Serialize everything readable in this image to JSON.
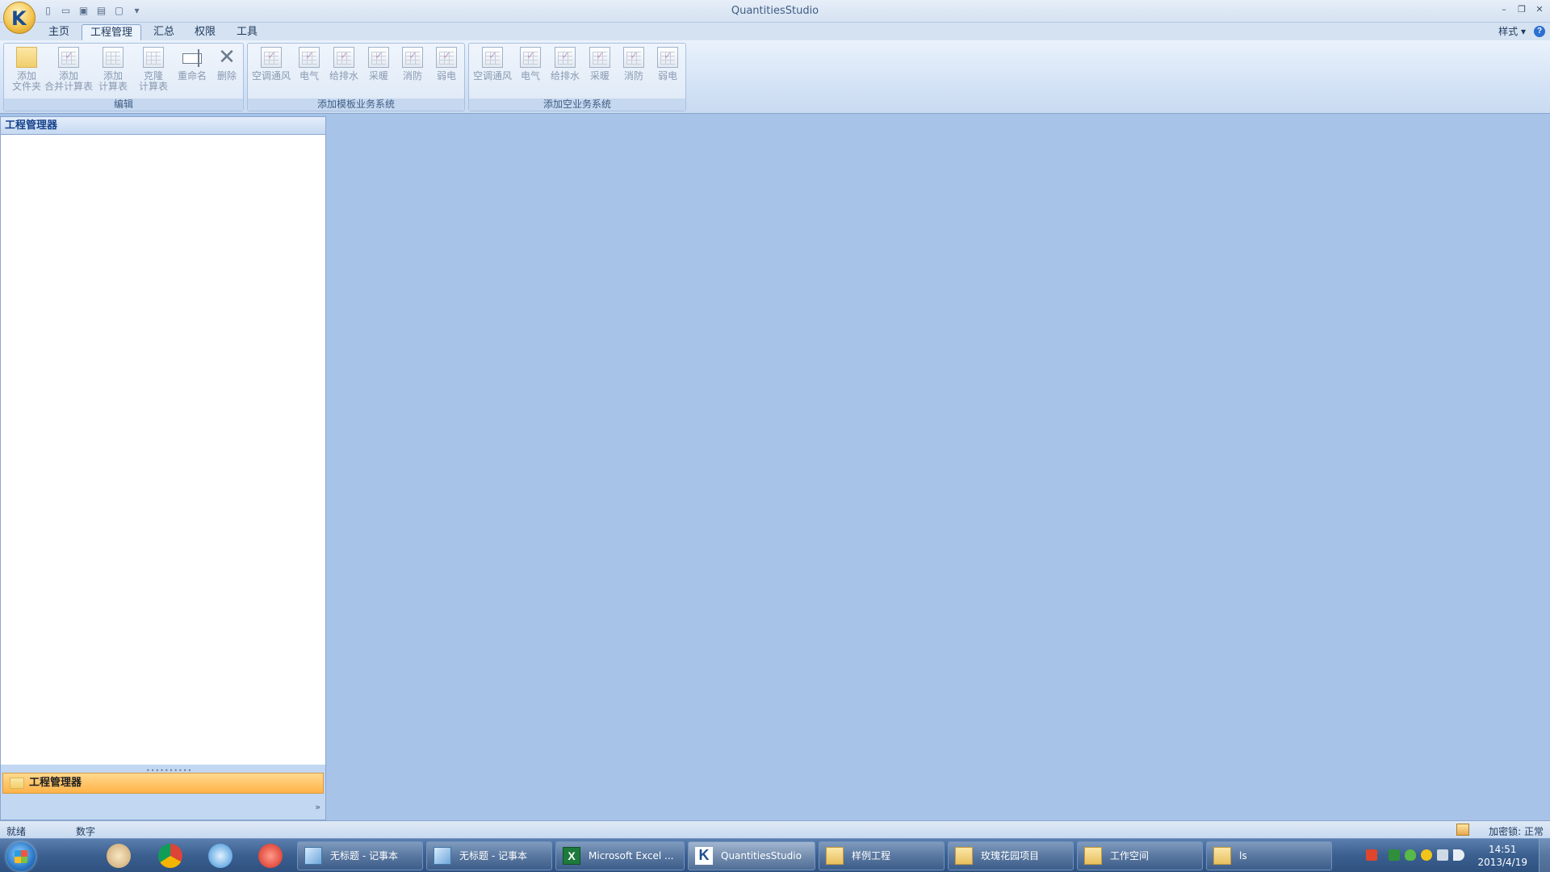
{
  "window": {
    "title": "QuantitiesStudio"
  },
  "tabs": [
    "主页",
    "工程管理",
    "汇总",
    "权限",
    "工具"
  ],
  "style_menu": "样式",
  "ribbon": {
    "edit_group": {
      "label": "编辑",
      "buttons": [
        {
          "line1": "添加",
          "line2": "文件夹"
        },
        {
          "line1": "添加",
          "line2": "合并计算表"
        },
        {
          "line1": "添加",
          "line2": "计算表"
        },
        {
          "line1": "克隆",
          "line2": "计算表"
        },
        {
          "line1": "重命名",
          "line2": ""
        },
        {
          "line1": "删除",
          "line2": ""
        }
      ]
    },
    "template_group": {
      "label": "添加模板业务系统",
      "buttons": [
        "空调通风",
        "电气",
        "给排水",
        "采暖",
        "消防",
        "弱电"
      ]
    },
    "empty_group": {
      "label": "添加空业务系统",
      "buttons": [
        "空调通风",
        "电气",
        "给排水",
        "采暖",
        "消防",
        "弱电"
      ]
    }
  },
  "left_panel": {
    "header": "工程管理器",
    "nav_item": "工程管理器"
  },
  "statusbar": {
    "ready": "就绪",
    "numlock": "数字",
    "lock_status": "加密锁: 正常"
  },
  "taskbar": {
    "tasks": [
      {
        "label": "无标题 - 记事本",
        "icon": "notepad-icon"
      },
      {
        "label": "无标题 - 记事本",
        "icon": "notepad-icon"
      },
      {
        "label": "Microsoft Excel ...",
        "icon": "excel-icon"
      },
      {
        "label": "QuantitiesStudio",
        "icon": "quantitiesstudio-icon"
      },
      {
        "label": "样例工程",
        "icon": "folder-icon"
      },
      {
        "label": "玫瑰花园项目",
        "icon": "folder-icon"
      },
      {
        "label": "工作空间",
        "icon": "folder-icon"
      },
      {
        "label": "ls",
        "icon": "folder-icon"
      }
    ],
    "clock": {
      "time": "14:51",
      "date": "2013/4/19"
    }
  }
}
